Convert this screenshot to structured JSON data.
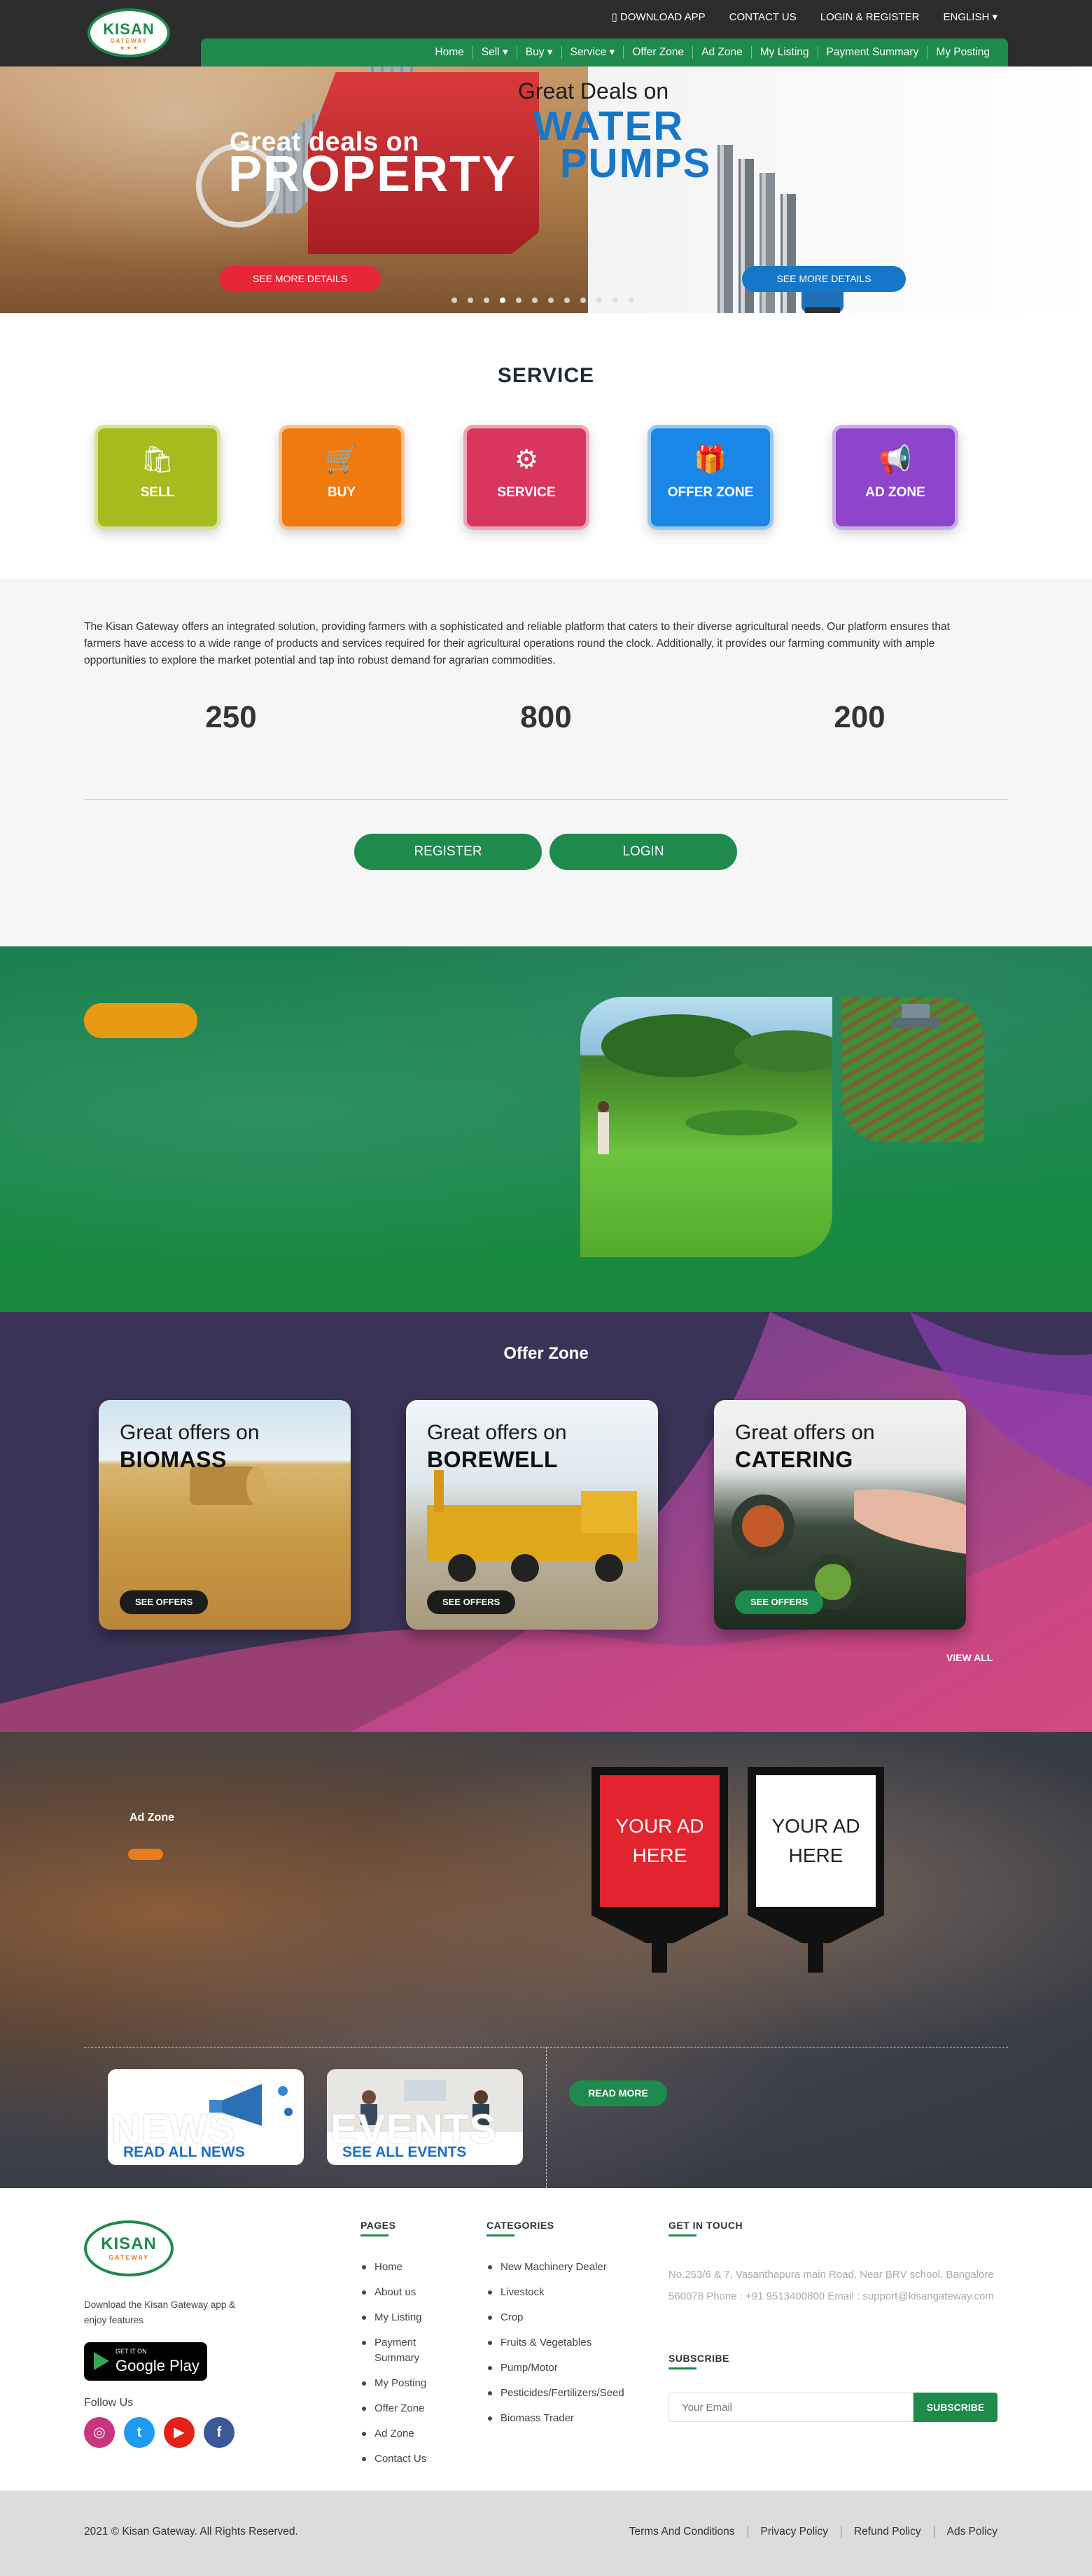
{
  "brand": {
    "logo_word": "KISAN",
    "logo_sub": "GATEWAY"
  },
  "topbar": {
    "download_app": "DOWNLOAD APP",
    "contact_us": "CONTACT US",
    "login_register": "LOGIN & REGISTER",
    "language": "ENGLISH"
  },
  "nav": {
    "items": [
      "Home",
      "Sell",
      "Buy",
      "Service",
      "Offer Zone",
      "Ad Zone",
      "My Listing",
      "Payment Summary",
      "My Posting"
    ]
  },
  "hero": {
    "property_small": "Great deals on",
    "property_big": "PROPERTY",
    "property_button": "SEE MORE DETAILS",
    "pumps_small": "Great Deals on",
    "pumps_big_1": "WATER",
    "pumps_big_2": "PUMPS",
    "pumps_button": "SEE MORE DETAILS",
    "slides": 12,
    "active_slide": 4
  },
  "service": {
    "title": "SERVICE",
    "cards": [
      {
        "label": "SELL",
        "icon": "shopping-bag-icon",
        "color": "#a6bc1e"
      },
      {
        "label": "BUY",
        "icon": "shopping-cart-icon",
        "color": "#ef7a10"
      },
      {
        "label": "SERVICE",
        "icon": "wrench-gear-icon",
        "color": "#d8365d"
      },
      {
        "label": "OFFER ZONE",
        "icon": "gift-hand-icon",
        "color": "#1a86e8"
      },
      {
        "label": "AD ZONE",
        "icon": "megaphone-icon",
        "color": "#8e45cc"
      }
    ]
  },
  "about": {
    "text": "The Kisan Gateway offers an integrated solution, providing farmers with a sophisticated and reliable platform that caters to their diverse agricultural needs. Our platform ensures that farmers have access to a wide range of products and services required for their agricultural operations round the clock. Additionally, it provides our farming community with ample opportunities to explore the market potential and tap into robust demand for agrarian commodities.",
    "stats": [
      "250",
      "800",
      "200"
    ],
    "register": "REGISTER",
    "login": "LOGIN"
  },
  "offer_zone": {
    "title": "Offer Zone",
    "cards": [
      {
        "line1": "Great offers on",
        "line2": "BIOMASS",
        "button": "SEE OFFERS",
        "button_color": "#1c1c1c"
      },
      {
        "line1": "Great offers on",
        "line2": "BOREWELL",
        "button": "SEE OFFERS",
        "button_color": "#1c1c1c"
      },
      {
        "line1": "Great offers on",
        "line2": "CATERING",
        "button": "SEE OFFERS",
        "button_color": "#1e8a4c"
      }
    ],
    "view_all": "VIEW ALL"
  },
  "ad_zone": {
    "label": "Ad Zone",
    "board_red": "YOUR AD HERE",
    "board_white": "YOUR AD HERE",
    "news_big": "NEWS",
    "news_link": "READ ALL NEWS",
    "events_big": "EVENTS",
    "events_link": "SEE ALL EVENTS",
    "read_more": "READ MORE"
  },
  "footer": {
    "download_text": "Download the Kisan Gateway app & enjoy features",
    "get_it_on": "GET IT ON",
    "google_play": "Google Play",
    "follow_us": "Follow Us",
    "pages_title": "PAGES",
    "pages": [
      "Home",
      "About us",
      "My Listing",
      "Payment Summary",
      "My Posting",
      "Offer Zone",
      "Ad Zone",
      "Contact Us"
    ],
    "categories_title": "CATEGORIES",
    "categories": [
      "New Machinery Dealer",
      "Livestock",
      "Crop",
      "Fruits & Vegetables",
      "Pump/Motor",
      "Pesticides/Fertilizers/Seed",
      "Biomass Trader"
    ],
    "contact_title": "GET IN TOUCH",
    "contact_text": "No.253/6 & 7, Vasanthapura main Road, Near BRV school, Bangalore 560078 Phone : +91 9513400800 Email : support@kisangateway.com",
    "subscribe_title": "SUBSCRIBE",
    "email_placeholder": "Your Email",
    "subscribe_button": "SUBSCRIBE",
    "copyright": "2021 © Kisan Gateway. All Rights Reserved.",
    "links": [
      "Terms And Conditions",
      "Privacy Policy",
      "Refund Policy",
      "Ads Policy"
    ]
  }
}
